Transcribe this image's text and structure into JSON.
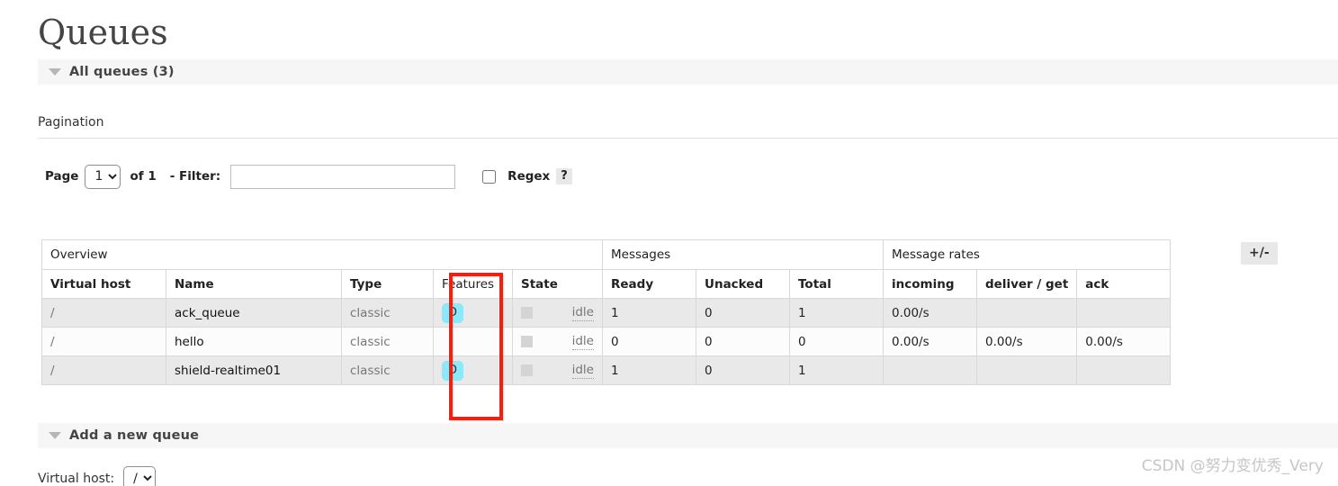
{
  "page": {
    "title": "Queues",
    "watermark": "CSDN @努力变优秀_Very"
  },
  "sections": {
    "all_queues": {
      "label": "All queues (3)",
      "toggle_icon": "triangle-down-icon"
    },
    "add_queue": {
      "label": "Add a new queue",
      "toggle_icon": "triangle-down-icon",
      "vhost_field_label": "Virtual host:",
      "vhost_value": "/"
    }
  },
  "pagination": {
    "heading": "Pagination",
    "page_label": "Page",
    "page_value": "1",
    "page_options": [
      "1"
    ],
    "of_label": "of 1",
    "filter_label": "- Filter:",
    "filter_value": "",
    "filter_placeholder": "",
    "regex_label": "Regex",
    "regex_checked": false,
    "help_label": "?"
  },
  "table": {
    "group_headers": [
      {
        "label": "Overview",
        "span": 5
      },
      {
        "label": "Messages",
        "span": 3
      },
      {
        "label": "Message rates",
        "span": 3
      }
    ],
    "columns": [
      {
        "label": "Virtual host",
        "bold": true,
        "align": "left"
      },
      {
        "label": "Name",
        "bold": true,
        "align": "left"
      },
      {
        "label": "Type",
        "bold": true,
        "align": "left"
      },
      {
        "label": "Features",
        "bold": false,
        "align": "left"
      },
      {
        "label": "State",
        "bold": true,
        "align": "left"
      },
      {
        "label": "Ready",
        "bold": true,
        "align": "left"
      },
      {
        "label": "Unacked",
        "bold": true,
        "align": "left"
      },
      {
        "label": "Total",
        "bold": true,
        "align": "left"
      },
      {
        "label": "incoming",
        "bold": true,
        "align": "left"
      },
      {
        "label": "deliver / get",
        "bold": true,
        "align": "left"
      },
      {
        "label": "ack",
        "bold": true,
        "align": "left"
      }
    ],
    "expand_button": "+/-",
    "rows": [
      {
        "vhost": "/",
        "name": "ack_queue",
        "type": "classic",
        "features": "D",
        "state": "idle",
        "ready": "1",
        "unacked": "0",
        "total": "1",
        "incoming": "0.00/s",
        "deliver_get": "",
        "ack": ""
      },
      {
        "vhost": "/",
        "name": "hello",
        "type": "classic",
        "features": "",
        "state": "idle",
        "ready": "0",
        "unacked": "0",
        "total": "0",
        "incoming": "0.00/s",
        "deliver_get": "0.00/s",
        "ack": "0.00/s"
      },
      {
        "vhost": "/",
        "name": "shield-realtime01",
        "type": "classic",
        "features": "D",
        "state": "idle",
        "ready": "1",
        "unacked": "0",
        "total": "1",
        "incoming": "",
        "deliver_get": "",
        "ack": ""
      }
    ]
  },
  "annotation": {
    "shape": "rectangle",
    "color": "#ff1b0c",
    "target": "features-column"
  },
  "colors": {
    "feature_badge_bg": "#8ae9fb",
    "annotation": "#ff1b0c",
    "section_bar_bg": "#f6f6f6",
    "row_alt_bg": "#e9e9e9"
  }
}
